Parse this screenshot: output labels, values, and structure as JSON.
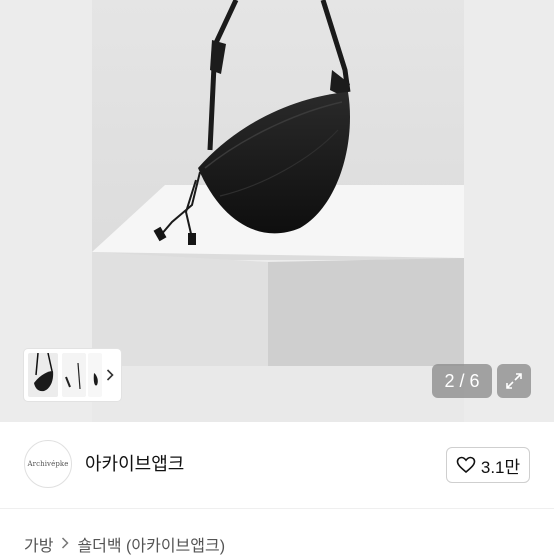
{
  "gallery": {
    "counter": "2 / 6",
    "thumbs_next_icon": "chevron-right-icon",
    "expand_icon": "expand-icon"
  },
  "seller": {
    "avatar_text": "Archivépke",
    "name": "아카이브앱크"
  },
  "like": {
    "icon": "heart-outline-icon",
    "count": "3.1만"
  },
  "breadcrumb": {
    "items": [
      "가방",
      "숄더백 (아카이브앱크)"
    ],
    "separator_icon": "chevron-right-icon"
  },
  "colors": {
    "background": "#ffffff",
    "photo_bg": "#e7e7e7",
    "overlay": "#8c8c8c",
    "text": "#111111"
  }
}
